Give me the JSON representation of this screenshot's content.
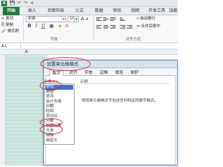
{
  "app": {
    "icon_letter": "X",
    "quick_access": [
      "💾",
      "↶",
      "↷",
      "▾"
    ]
  },
  "ribbon_tabs": [
    {
      "label": "开始",
      "active": true
    },
    {
      "label": "插入"
    },
    {
      "label": "页面布局"
    },
    {
      "label": "公式"
    },
    {
      "label": "数据"
    },
    {
      "label": "审阅"
    },
    {
      "label": "视图"
    },
    {
      "label": "开发工具"
    },
    {
      "label": "加载项"
    }
  ],
  "clipboard": {
    "cut": "剪切",
    "copy": "复制",
    "format_painter": "格式刷",
    "paste_label": "粘贴"
  },
  "font": {
    "family_value": "宋体",
    "size_value": "10",
    "group_label": "字体",
    "buttons": [
      "B",
      "I",
      "U"
    ],
    "grow": "A",
    "shrink": "A"
  },
  "alignment": {
    "wrap_text": "自动换行",
    "merge_center": "合并后居中",
    "group_label": "对齐方式"
  },
  "formula_bar": {
    "name_box": "A1"
  },
  "sheet": {
    "column_a": "A"
  },
  "dialog": {
    "title": "设置单元格格式",
    "tabs": [
      {
        "label": "数字",
        "active": true
      },
      {
        "label": "对齐"
      },
      {
        "label": "字体"
      },
      {
        "label": "边框"
      },
      {
        "label": "填充"
      },
      {
        "label": "保护"
      }
    ],
    "category_label": "分类(C):",
    "categories": [
      "常规",
      "数值",
      "货币",
      "会计专用",
      "日期",
      "时间",
      "百分比",
      "分数",
      "科学记数",
      "文本",
      "特殊",
      "自定义"
    ],
    "selected_category": "常规",
    "sample_label": "示例",
    "description": "常规单元格格式不包含任何特定的数字格式。"
  },
  "colors": {
    "excel_green": "#1f7a3a",
    "annotation_red": "#e0262c",
    "selection_blue": "#3f76c4"
  }
}
